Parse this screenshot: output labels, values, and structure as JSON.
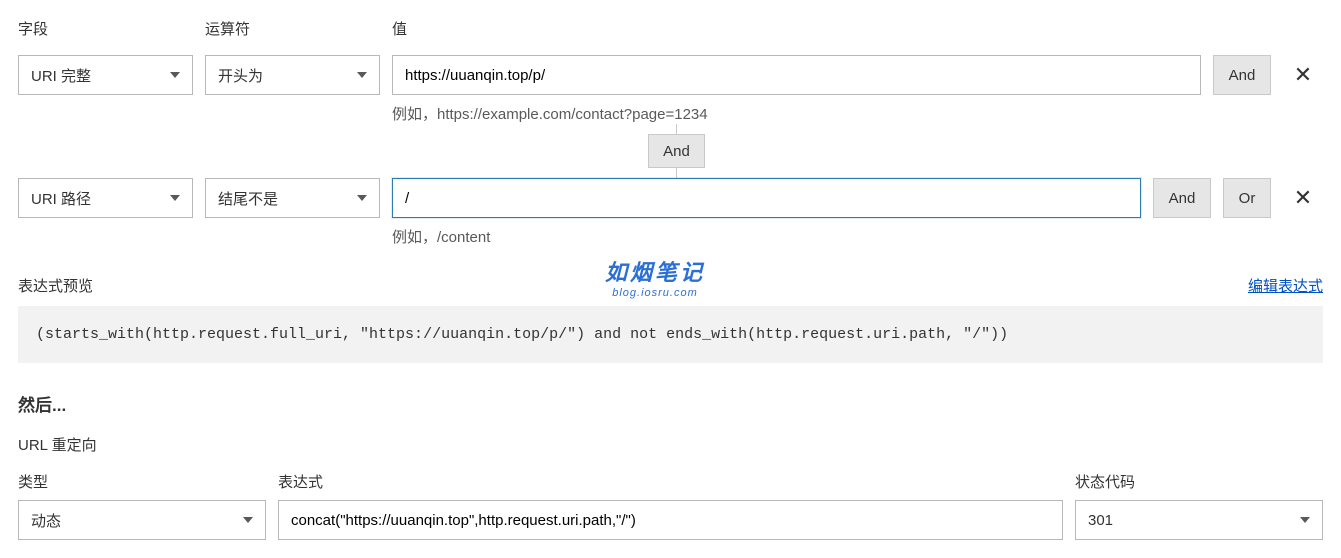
{
  "labels": {
    "field": "字段",
    "operator": "运算符",
    "value": "值"
  },
  "rows": [
    {
      "field": "URI 完整",
      "operator": "开头为",
      "value": "https://uuanqin.top/p/",
      "hint": "例如，https://example.com/contact?page=1234",
      "buttons": {
        "and": "And"
      }
    },
    {
      "field": "URI 路径",
      "operator": "结尾不是",
      "value": "/",
      "hint": "例如，/content",
      "buttons": {
        "and": "And",
        "or": "Or"
      }
    }
  ],
  "connector": {
    "and": "And"
  },
  "preview": {
    "title": "表达式预览",
    "edit_link": "编辑表达式",
    "code": "(starts_with(http.request.full_uri, \"https://uuanqin.top/p/\") and not ends_with(http.request.uri.path, \"/\"))"
  },
  "then": {
    "header": "然后...",
    "subheader": "URL 重定向",
    "type_label": "类型",
    "type_value": "动态",
    "expr_label": "表达式",
    "expr_value": "concat(\"https://uuanqin.top\",http.request.uri.path,\"/\")",
    "status_label": "状态代码",
    "status_value": "301"
  },
  "watermark": {
    "cn": "如烟笔记",
    "en": "blog.iosru.com"
  }
}
